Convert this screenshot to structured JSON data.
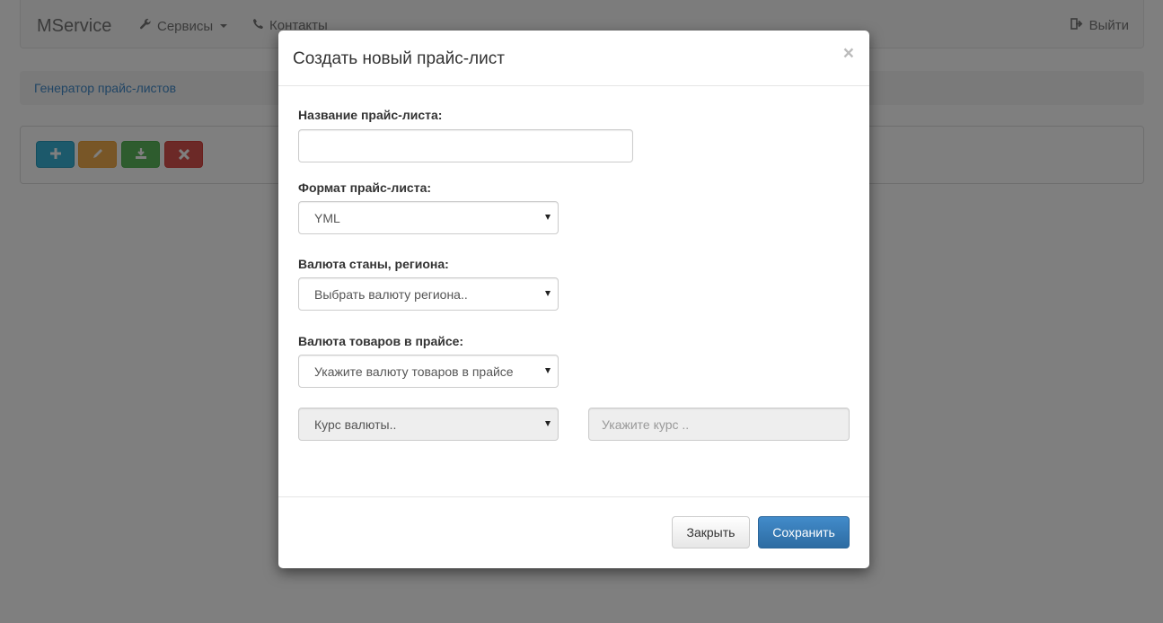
{
  "navbar": {
    "brand": "MService",
    "services_label": "Сервисы",
    "contacts_label": "Контакты",
    "logout_label": "Выйти"
  },
  "breadcrumb": {
    "label": "Генератор прайс-листов"
  },
  "toolbar": {
    "add_icon": "plus-icon",
    "edit_icon": "pencil-icon",
    "download_icon": "download-icon",
    "delete_icon": "x-icon"
  },
  "modal": {
    "title": "Создать новый прайс-лист",
    "close_symbol": "×",
    "fields": {
      "name_label": "Название прайс-листа:",
      "name_value": "",
      "format_label": "Формат прайс-листа:",
      "format_value": "YML",
      "region_currency_label": "Валюта станы, региона:",
      "region_currency_value": "Выбрать валюту региона..",
      "goods_currency_label": "Валюта товаров в прайсе:",
      "goods_currency_value": "Укажите валюту товаров в прайсе",
      "rate_select_value": "Курс валюты..",
      "rate_input_placeholder": "Укажите курс .."
    },
    "footer": {
      "close_label": "Закрыть",
      "save_label": "Сохранить"
    }
  },
  "colors": {
    "primary": "#428bca",
    "info": "#39b3d7",
    "warning": "#f0ad4e",
    "success": "#5cb85c",
    "danger": "#d9534f"
  }
}
